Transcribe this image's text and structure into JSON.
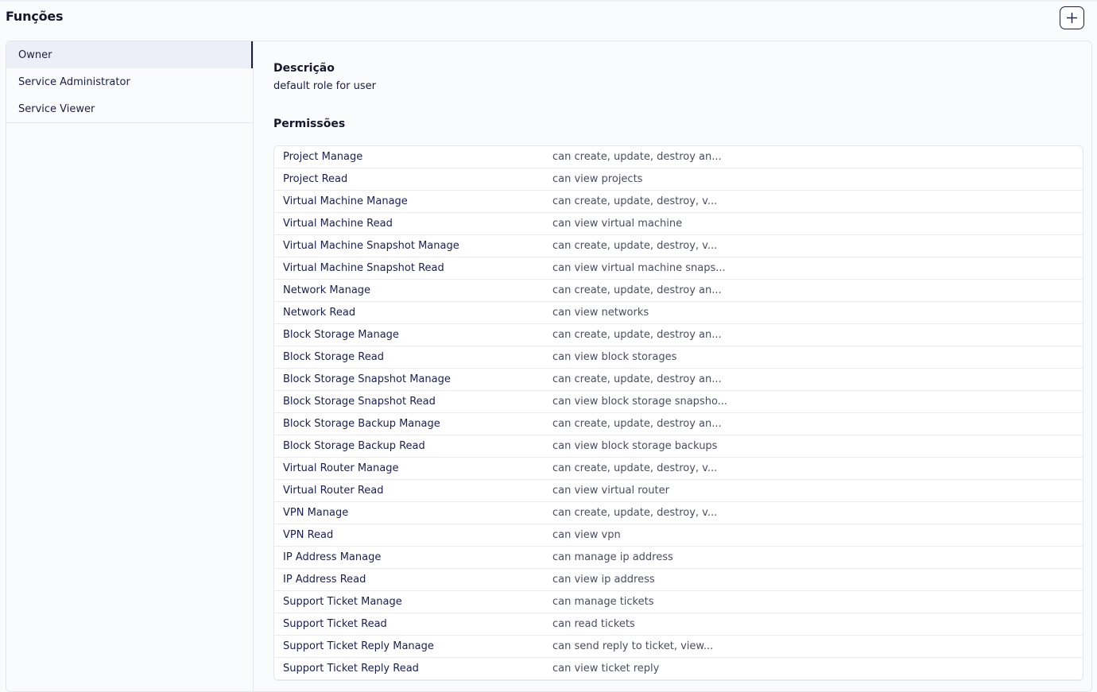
{
  "header": {
    "title": "Funções"
  },
  "roles": [
    {
      "label": "Owner",
      "active": true
    },
    {
      "label": "Service Administrator",
      "active": false
    },
    {
      "label": "Service Viewer",
      "active": false
    }
  ],
  "details": {
    "description_label": "Descrição",
    "description_value": "default role for user",
    "permissions_label": "Permissões"
  },
  "permissions": [
    {
      "name": "Project Manage",
      "desc": "can create, update, destroy an..."
    },
    {
      "name": "Project Read",
      "desc": "can view projects"
    },
    {
      "name": "Virtual Machine Manage",
      "desc": "can create, update, destroy, v..."
    },
    {
      "name": "Virtual Machine Read",
      "desc": "can view virtual machine"
    },
    {
      "name": "Virtual Machine Snapshot Manage",
      "desc": "can create, update, destroy, v..."
    },
    {
      "name": "Virtual Machine Snapshot Read",
      "desc": "can view virtual machine snaps..."
    },
    {
      "name": "Network Manage",
      "desc": "can create, update, destroy an..."
    },
    {
      "name": "Network Read",
      "desc": "can view networks"
    },
    {
      "name": "Block Storage Manage",
      "desc": "can create, update, destroy an..."
    },
    {
      "name": "Block Storage Read",
      "desc": "can view block storages"
    },
    {
      "name": "Block Storage Snapshot Manage",
      "desc": "can create, update, destroy an..."
    },
    {
      "name": "Block Storage Snapshot Read",
      "desc": "can view block storage snapsho..."
    },
    {
      "name": "Block Storage Backup Manage",
      "desc": "can create, update, destroy an..."
    },
    {
      "name": "Block Storage Backup Read",
      "desc": "can view block storage backups"
    },
    {
      "name": "Virtual Router Manage",
      "desc": "can create, update, destroy, v..."
    },
    {
      "name": "Virtual Router Read",
      "desc": "can view virtual router"
    },
    {
      "name": "VPN Manage",
      "desc": "can create, update, destroy, v..."
    },
    {
      "name": "VPN Read",
      "desc": "can view vpn"
    },
    {
      "name": "IP Address Manage",
      "desc": "can manage ip address"
    },
    {
      "name": "IP Address Read",
      "desc": "can view ip address"
    },
    {
      "name": "Support Ticket Manage",
      "desc": "can manage tickets"
    },
    {
      "name": "Support Ticket Read",
      "desc": "can read tickets"
    },
    {
      "name": "Support Ticket Reply Manage",
      "desc": "can send reply to ticket, view..."
    },
    {
      "name": "Support Ticket Reply Read",
      "desc": "can view ticket reply"
    }
  ],
  "icons": {
    "add": "plus-icon"
  },
  "colors": {
    "text": "#1b1e3d",
    "active_bg": "#eceff7",
    "border": "#e3e6ec"
  }
}
